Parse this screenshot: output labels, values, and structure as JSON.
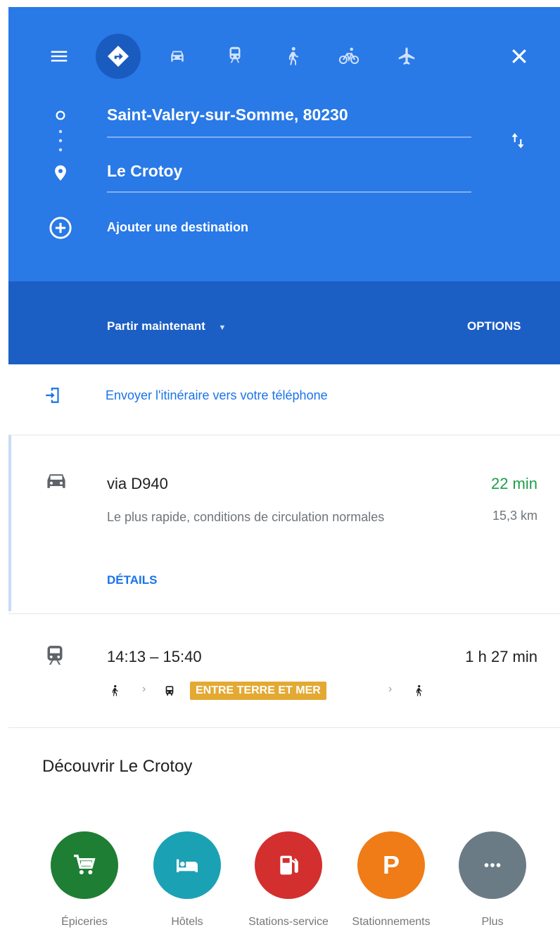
{
  "header": {
    "menu_icon": "menu-icon",
    "modes": [
      "directions-icon",
      "car-icon",
      "transit-icon",
      "walk-icon",
      "bike-icon",
      "flight-icon"
    ],
    "close_icon": "close-icon",
    "origin": "Saint-Valery-sur-Somme, 80230",
    "destination": "Le Crotoy",
    "add_destination": "Ajouter une destination",
    "depart_label": "Partir maintenant",
    "options_label": "OPTIONS"
  },
  "send_to_phone": "Envoyer l'itinéraire vers votre téléphone",
  "routes": {
    "car": {
      "title": "via D940",
      "duration": "22 min",
      "description": "Le plus rapide, conditions de circulation normales",
      "distance": "15,3 km",
      "details_label": "DÉTAILS"
    },
    "transit": {
      "times": "14:13 – 15:40",
      "duration": "1 h 27 min",
      "line_name": "ENTRE TERRE ET MER"
    }
  },
  "discover": {
    "title": "Découvrir Le Crotoy",
    "categories": [
      {
        "label": "Épiceries",
        "color": "#1e7e34",
        "icon": "cart-icon"
      },
      {
        "label": "Hôtels",
        "color": "#1ba1b4",
        "icon": "bed-icon"
      },
      {
        "label": "Stations-service",
        "color": "#d32f2f",
        "icon": "fuel-icon"
      },
      {
        "label": "Stationnements",
        "color": "#ef7c16",
        "icon": "parking-icon"
      },
      {
        "label": "Plus",
        "color": "#6b7b86",
        "icon": "more-icon"
      }
    ]
  },
  "colors": {
    "primary_blue": "#2979e7",
    "dark_blue": "#1c5fc4",
    "link_blue": "#1a73e8",
    "duration_green": "#1e9e4a",
    "badge_yellow": "#e3a932"
  }
}
